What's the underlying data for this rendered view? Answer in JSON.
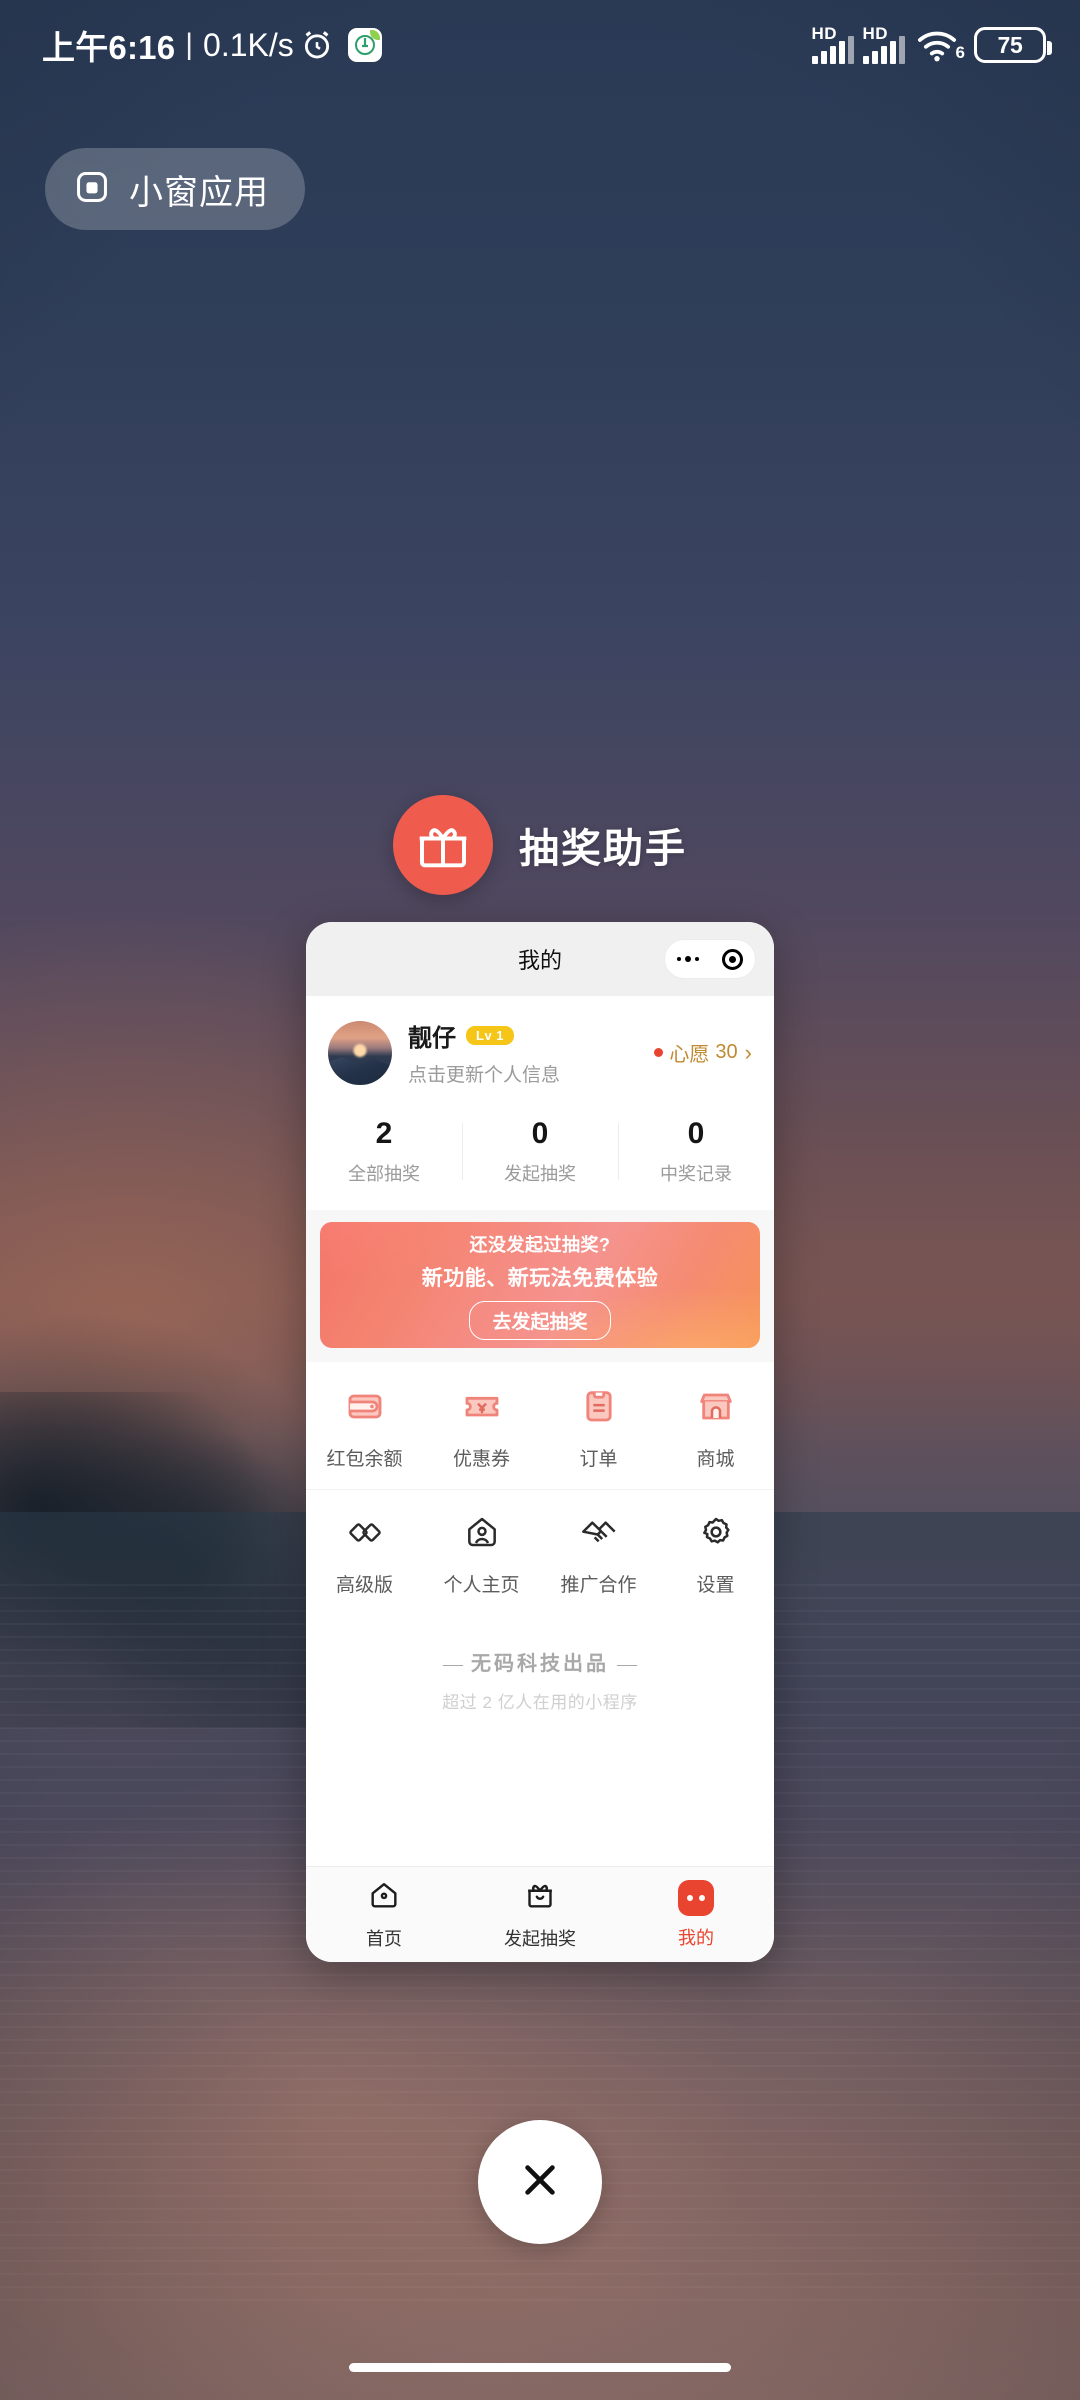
{
  "status_bar": {
    "time": "上午6:16",
    "separator": "|",
    "network_speed": "0.1K/s",
    "alarm_icon": "alarm-clock-icon",
    "app_icon": "fitness-app-icon",
    "signal_1_label": "HD",
    "signal_2_label": "HD",
    "wifi_label": "6",
    "battery_level": "75"
  },
  "floating_window": {
    "pill_label": "小窗应用",
    "pill_icon": "small-window-icon"
  },
  "app_header": {
    "name": "抽奖助手",
    "icon": "gift-icon",
    "icon_bg": "#ef5c4e"
  },
  "mini_program": {
    "nav": {
      "title": "我的",
      "more_icon": "more-dots-icon",
      "close_icon": "target-circle-icon"
    },
    "profile": {
      "avatar": "user-avatar-sunset",
      "name": "靓仔",
      "level_badge": "Lv 1",
      "subtitle": "点击更新个人信息",
      "wish_label": "心愿",
      "wish_count": "30",
      "arrow": "›"
    },
    "stats": [
      {
        "value": "2",
        "label": "全部抽奖"
      },
      {
        "value": "0",
        "label": "发起抽奖"
      },
      {
        "value": "0",
        "label": "中奖记录"
      }
    ],
    "banner": {
      "line1": "还没发起过抽奖?",
      "line2": "新功能、新玩法免费体验",
      "button": "去发起抽奖"
    },
    "grid_row1": [
      {
        "label": "红包余额",
        "icon": "wallet-icon"
      },
      {
        "label": "优惠券",
        "icon": "coupon-icon"
      },
      {
        "label": "订单",
        "icon": "order-clipboard-icon"
      },
      {
        "label": "商城",
        "icon": "shop-store-icon"
      }
    ],
    "grid_row2": [
      {
        "label": "高级版",
        "icon": "diamonds-icon"
      },
      {
        "label": "个人主页",
        "icon": "person-home-icon"
      },
      {
        "label": "推广合作",
        "icon": "handshake-icon"
      },
      {
        "label": "设置",
        "icon": "gear-icon"
      }
    ],
    "brand": {
      "dash_left": "—",
      "title": "无码科技出品",
      "dash_right": "—",
      "subtitle": "超过 2 亿人在用的小程序"
    },
    "tabbar": [
      {
        "label": "首页",
        "icon": "home-icon",
        "active": false
      },
      {
        "label": "发起抽奖",
        "icon": "gift-box-icon",
        "active": false
      },
      {
        "label": "我的",
        "icon": "profile-face-icon",
        "active": true
      }
    ]
  },
  "close_button": {
    "icon": "close-x-icon"
  },
  "colors": {
    "accent_red": "#e8442f",
    "app_coral": "#ef5c4e",
    "gold": "#c08a33",
    "level_badge": "#f5c518"
  }
}
